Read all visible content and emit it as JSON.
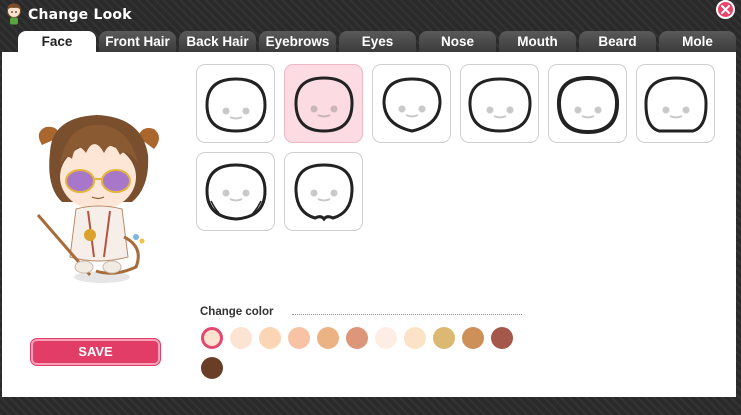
{
  "window": {
    "title": "Change Look"
  },
  "tabs": [
    {
      "label": "Face",
      "active": true
    },
    {
      "label": "Front Hair",
      "active": false
    },
    {
      "label": "Back Hair",
      "active": false
    },
    {
      "label": "Eyebrows",
      "active": false
    },
    {
      "label": "Eyes",
      "active": false
    },
    {
      "label": "Nose",
      "active": false
    },
    {
      "label": "Mouth",
      "active": false
    },
    {
      "label": "Beard",
      "active": false
    },
    {
      "label": "Mole",
      "active": false
    }
  ],
  "face_options": [
    {
      "shape": "round",
      "selected": false
    },
    {
      "shape": "round-soft",
      "selected": true
    },
    {
      "shape": "oval",
      "selected": false
    },
    {
      "shape": "wide",
      "selected": false
    },
    {
      "shape": "round-bold",
      "selected": false
    },
    {
      "shape": "square-jaw",
      "selected": false
    },
    {
      "shape": "cheeks",
      "selected": false
    },
    {
      "shape": "cleft-chin",
      "selected": false
    }
  ],
  "save_button": {
    "label": "SAVE"
  },
  "color_section": {
    "label": "Change color",
    "swatches": [
      {
        "color": "#fde2cf",
        "selected": true
      },
      {
        "color": "#fde4d2",
        "selected": false
      },
      {
        "color": "#fcd6b4",
        "selected": false
      },
      {
        "color": "#f7c3a4",
        "selected": false
      },
      {
        "color": "#ebb284",
        "selected": false
      },
      {
        "color": "#dc967a",
        "selected": false
      },
      {
        "color": "#fdede5",
        "selected": false
      },
      {
        "color": "#fce2c6",
        "selected": false
      },
      {
        "color": "#dcb872",
        "selected": false
      },
      {
        "color": "#cd9058",
        "selected": false
      },
      {
        "color": "#a4574a",
        "selected": false
      },
      {
        "color": "#6a3e26",
        "selected": false
      }
    ]
  }
}
